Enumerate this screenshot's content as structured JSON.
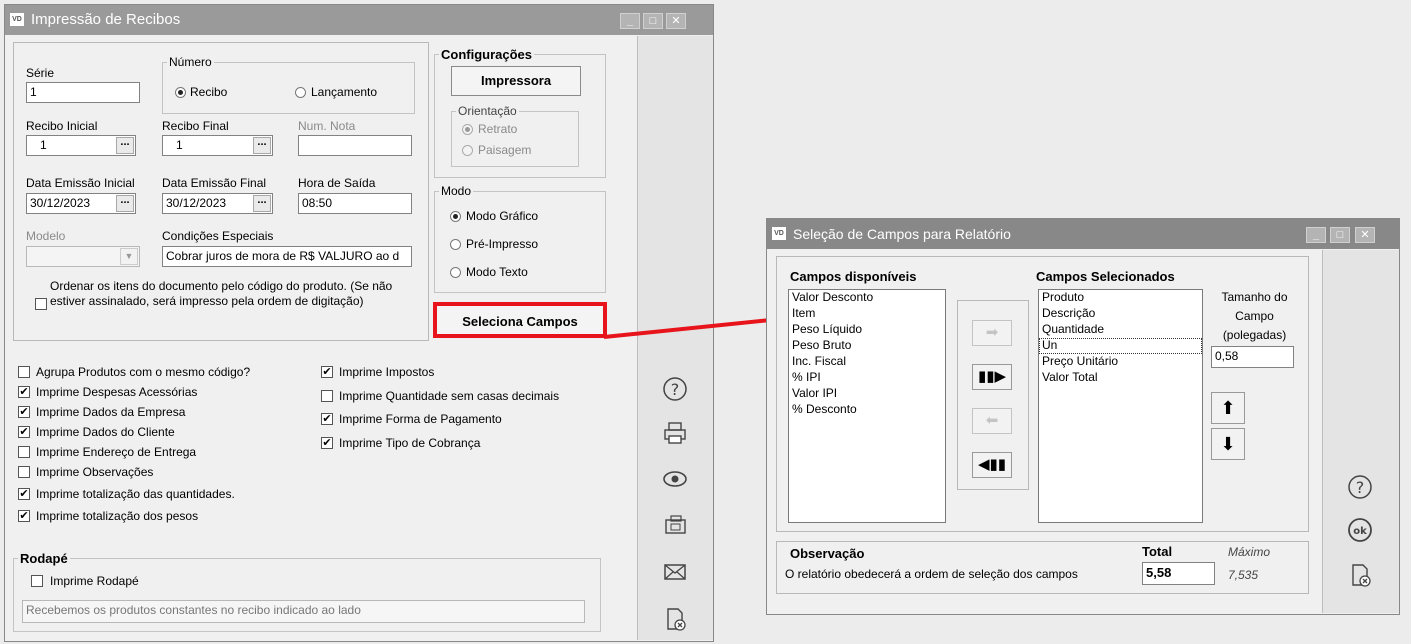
{
  "main_window": {
    "title": "Impressão de Recibos",
    "logo": "VD",
    "serie": {
      "label": "Série",
      "value": "1"
    },
    "numero": {
      "legend": "Número",
      "options": [
        "Recibo",
        "Lançamento"
      ],
      "selected": "Recibo"
    },
    "recibo_inicial": {
      "label": "Recibo Inicial",
      "value": "1"
    },
    "recibo_final": {
      "label": "Recibo Final",
      "value": "1"
    },
    "num_nota": {
      "label": "Num. Nota",
      "value": ""
    },
    "data_emissao_inicial": {
      "label": "Data Emissão Inicial",
      "value": "30/12/2023"
    },
    "data_emissao_final": {
      "label": "Data Emissão Final",
      "value": "30/12/2023"
    },
    "hora_saida": {
      "label": "Hora de Saída",
      "value": "08:50"
    },
    "modelo": {
      "label": "Modelo",
      "value": ""
    },
    "condicoes_especiais": {
      "label": "Condições Especiais",
      "value": "Cobrar juros de mora de R$ VALJURO ao d"
    },
    "ordenar": {
      "text": "Ordenar os itens do documento pelo código do produto. (Se não estiver assinalado, será impresso pela ordem de digitação)",
      "checked": false
    },
    "configuracoes": {
      "legend": "Configurações",
      "printer_button": "Impressora"
    },
    "orientacao": {
      "legend": "Orientação",
      "options": [
        "Retrato",
        "Paisagem"
      ],
      "selected": "Retrato"
    },
    "modo": {
      "legend": "Modo",
      "options": [
        "Modo Gráfico",
        "Pré-Impresso",
        "Modo Texto"
      ],
      "selected": "Modo Gráfico"
    },
    "seleciona_campos_button": "Seleciona Campos",
    "options_left": [
      {
        "label": "Agrupa Produtos com o mesmo código?",
        "checked": false
      },
      {
        "label": "Imprime Despesas Acessórias",
        "checked": true
      },
      {
        "label": "Imprime Dados da Empresa",
        "checked": true
      },
      {
        "label": "Imprime Dados do Cliente",
        "checked": true
      },
      {
        "label": "Imprime Endereço de Entrega",
        "checked": false
      },
      {
        "label": "Imprime Observações",
        "checked": false
      },
      {
        "label": "Imprime totalização das quantidades.",
        "checked": true
      },
      {
        "label": "Imprime totalização dos pesos",
        "checked": true
      }
    ],
    "options_right": [
      {
        "label": "Imprime Impostos",
        "checked": true
      },
      {
        "label": "Imprime Quantidade sem casas decimais",
        "checked": false
      },
      {
        "label": "Imprime Forma de Pagamento",
        "checked": true
      },
      {
        "label": "Imprime Tipo de Cobrança",
        "checked": true
      }
    ],
    "rodape": {
      "legend": "Rodapé",
      "checkbox_label": "Imprime Rodapé",
      "checked": false,
      "text": "Recebemos os produtos constantes no recibo indicado ao lado"
    },
    "sidebar_icons": [
      "help-icon",
      "printer-icon",
      "preview-icon",
      "fax-icon",
      "email-icon",
      "cancel-icon"
    ]
  },
  "dialog": {
    "title": "Seleção de Campos para Relatório",
    "logo": "VD",
    "available_header": "Campos disponíveis",
    "available": [
      "Valor Desconto",
      "Item",
      "Peso Líquido",
      "Peso Bruto",
      "Inc. Fiscal",
      "% IPI",
      "Valor IPI",
      "% Desconto"
    ],
    "selected_header": "Campos Selecionados",
    "selected": [
      "Produto",
      "Descrição",
      "Quantidade",
      "Un",
      "Preço Unitário",
      "Valor Total"
    ],
    "focused_item": "Un",
    "tamanho_label": "Tamanho do Campo (polegadas)",
    "tamanho_value": "0,58",
    "observacao_header": "Observação",
    "observacao_text": "O relatório obedecerá a ordem de seleção dos campos",
    "total_label": "Total",
    "total_value": "5,58",
    "maximo_label": "Máximo",
    "maximo_value": "7,535",
    "sidebar_icons": [
      "help-icon",
      "ok-icon",
      "cancel-icon"
    ]
  },
  "colors": {
    "highlight": "#e8141c",
    "titlebar": "#9a9a9a"
  }
}
